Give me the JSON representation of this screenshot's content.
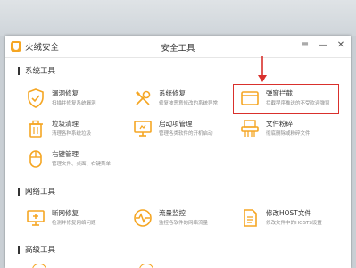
{
  "window": {
    "brand_name": "火绒安全",
    "title": "安全工具",
    "buttons": {
      "menu": "≡",
      "minimize": "—",
      "close": "✕"
    }
  },
  "sections": [
    {
      "title": "系统工具",
      "tools": [
        {
          "title": "漏洞修复",
          "desc": "扫描并修复系统漏洞",
          "icon": "shield-check-icon"
        },
        {
          "title": "系统修复",
          "desc": "修复被恶意修改的系统异常",
          "icon": "wrench-screwdriver-icon"
        },
        {
          "title": "弹窗拦截",
          "desc": "拦截程序推送的不受欢迎弹窗",
          "icon": "popup-window-icon"
        },
        {
          "title": "垃圾清理",
          "desc": "清理各种系统垃圾",
          "icon": "trash-icon"
        },
        {
          "title": "启动项管理",
          "desc": "管理各类软件的开机启动",
          "icon": "monitor-icon"
        },
        {
          "title": "文件粉碎",
          "desc": "彻底删除或粉碎文件",
          "icon": "shredder-icon"
        },
        {
          "title": "右键管理",
          "desc": "管理文件、桌面、右键菜单",
          "icon": "mouse-icon"
        }
      ]
    },
    {
      "title": "网络工具",
      "tools": [
        {
          "title": "断网修复",
          "desc": "检测并修复网络问题",
          "icon": "network-repair-icon"
        },
        {
          "title": "流量监控",
          "desc": "监控各软件的网络流量",
          "icon": "pulse-icon"
        },
        {
          "title": "修改HOST文件",
          "desc": "修改文件中的HOSTS设置",
          "icon": "host-file-icon"
        }
      ]
    },
    {
      "title": "高级工具",
      "tools": []
    }
  ],
  "colors": {
    "accent": "#f5a623",
    "highlight": "#d9302c",
    "text": "#333333",
    "desc": "#8a8a8a"
  }
}
